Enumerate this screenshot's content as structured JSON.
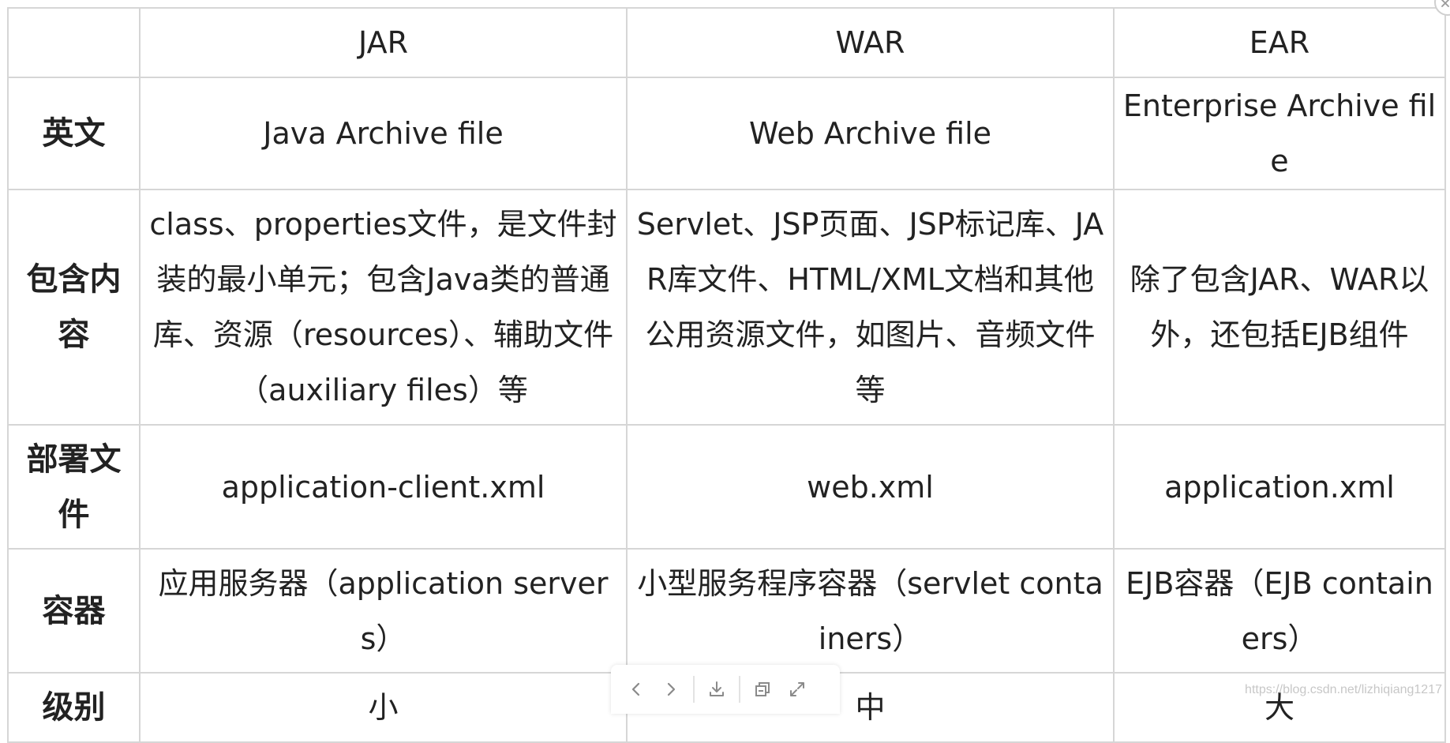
{
  "table": {
    "corner": "",
    "headers": [
      "JAR",
      "WAR",
      "EAR"
    ],
    "rows": [
      {
        "label": "英文",
        "cells": [
          "Java Archive file",
          "Web Archive file",
          "Enterprise Archive file"
        ]
      },
      {
        "label": "包含内容",
        "cells": [
          "class、properties文件，是文件封装的最小单元；包含Java类的普通库、资源（resources）、辅助文件（auxiliary files）等",
          "Servlet、JSP页面、JSP标记库、JAR库文件、HTML/XML文档和其他公用资源文件，如图片、音频文件等",
          "除了包含JAR、WAR以外，还包括EJB组件"
        ]
      },
      {
        "label": "部署文件",
        "cells": [
          "application-client.xml",
          "web.xml",
          "application.xml"
        ]
      },
      {
        "label": "容器",
        "cells": [
          "应用服务器（application servers）",
          "小型服务程序容器（servlet containers）",
          "EJB容器（EJB containers）"
        ]
      },
      {
        "label": "级别",
        "cells": [
          "小",
          "中",
          "大"
        ]
      }
    ]
  },
  "toolbar": {
    "icons": [
      "chevron-left-icon",
      "chevron-right-icon",
      "download-icon",
      "copy-icon",
      "expand-icon"
    ]
  },
  "watermark": "https://blog.csdn.net/lizhiqiang1217",
  "colors": {
    "border": "#d6d6d6",
    "text": "#222222",
    "icon": "#8a8a8a"
  }
}
